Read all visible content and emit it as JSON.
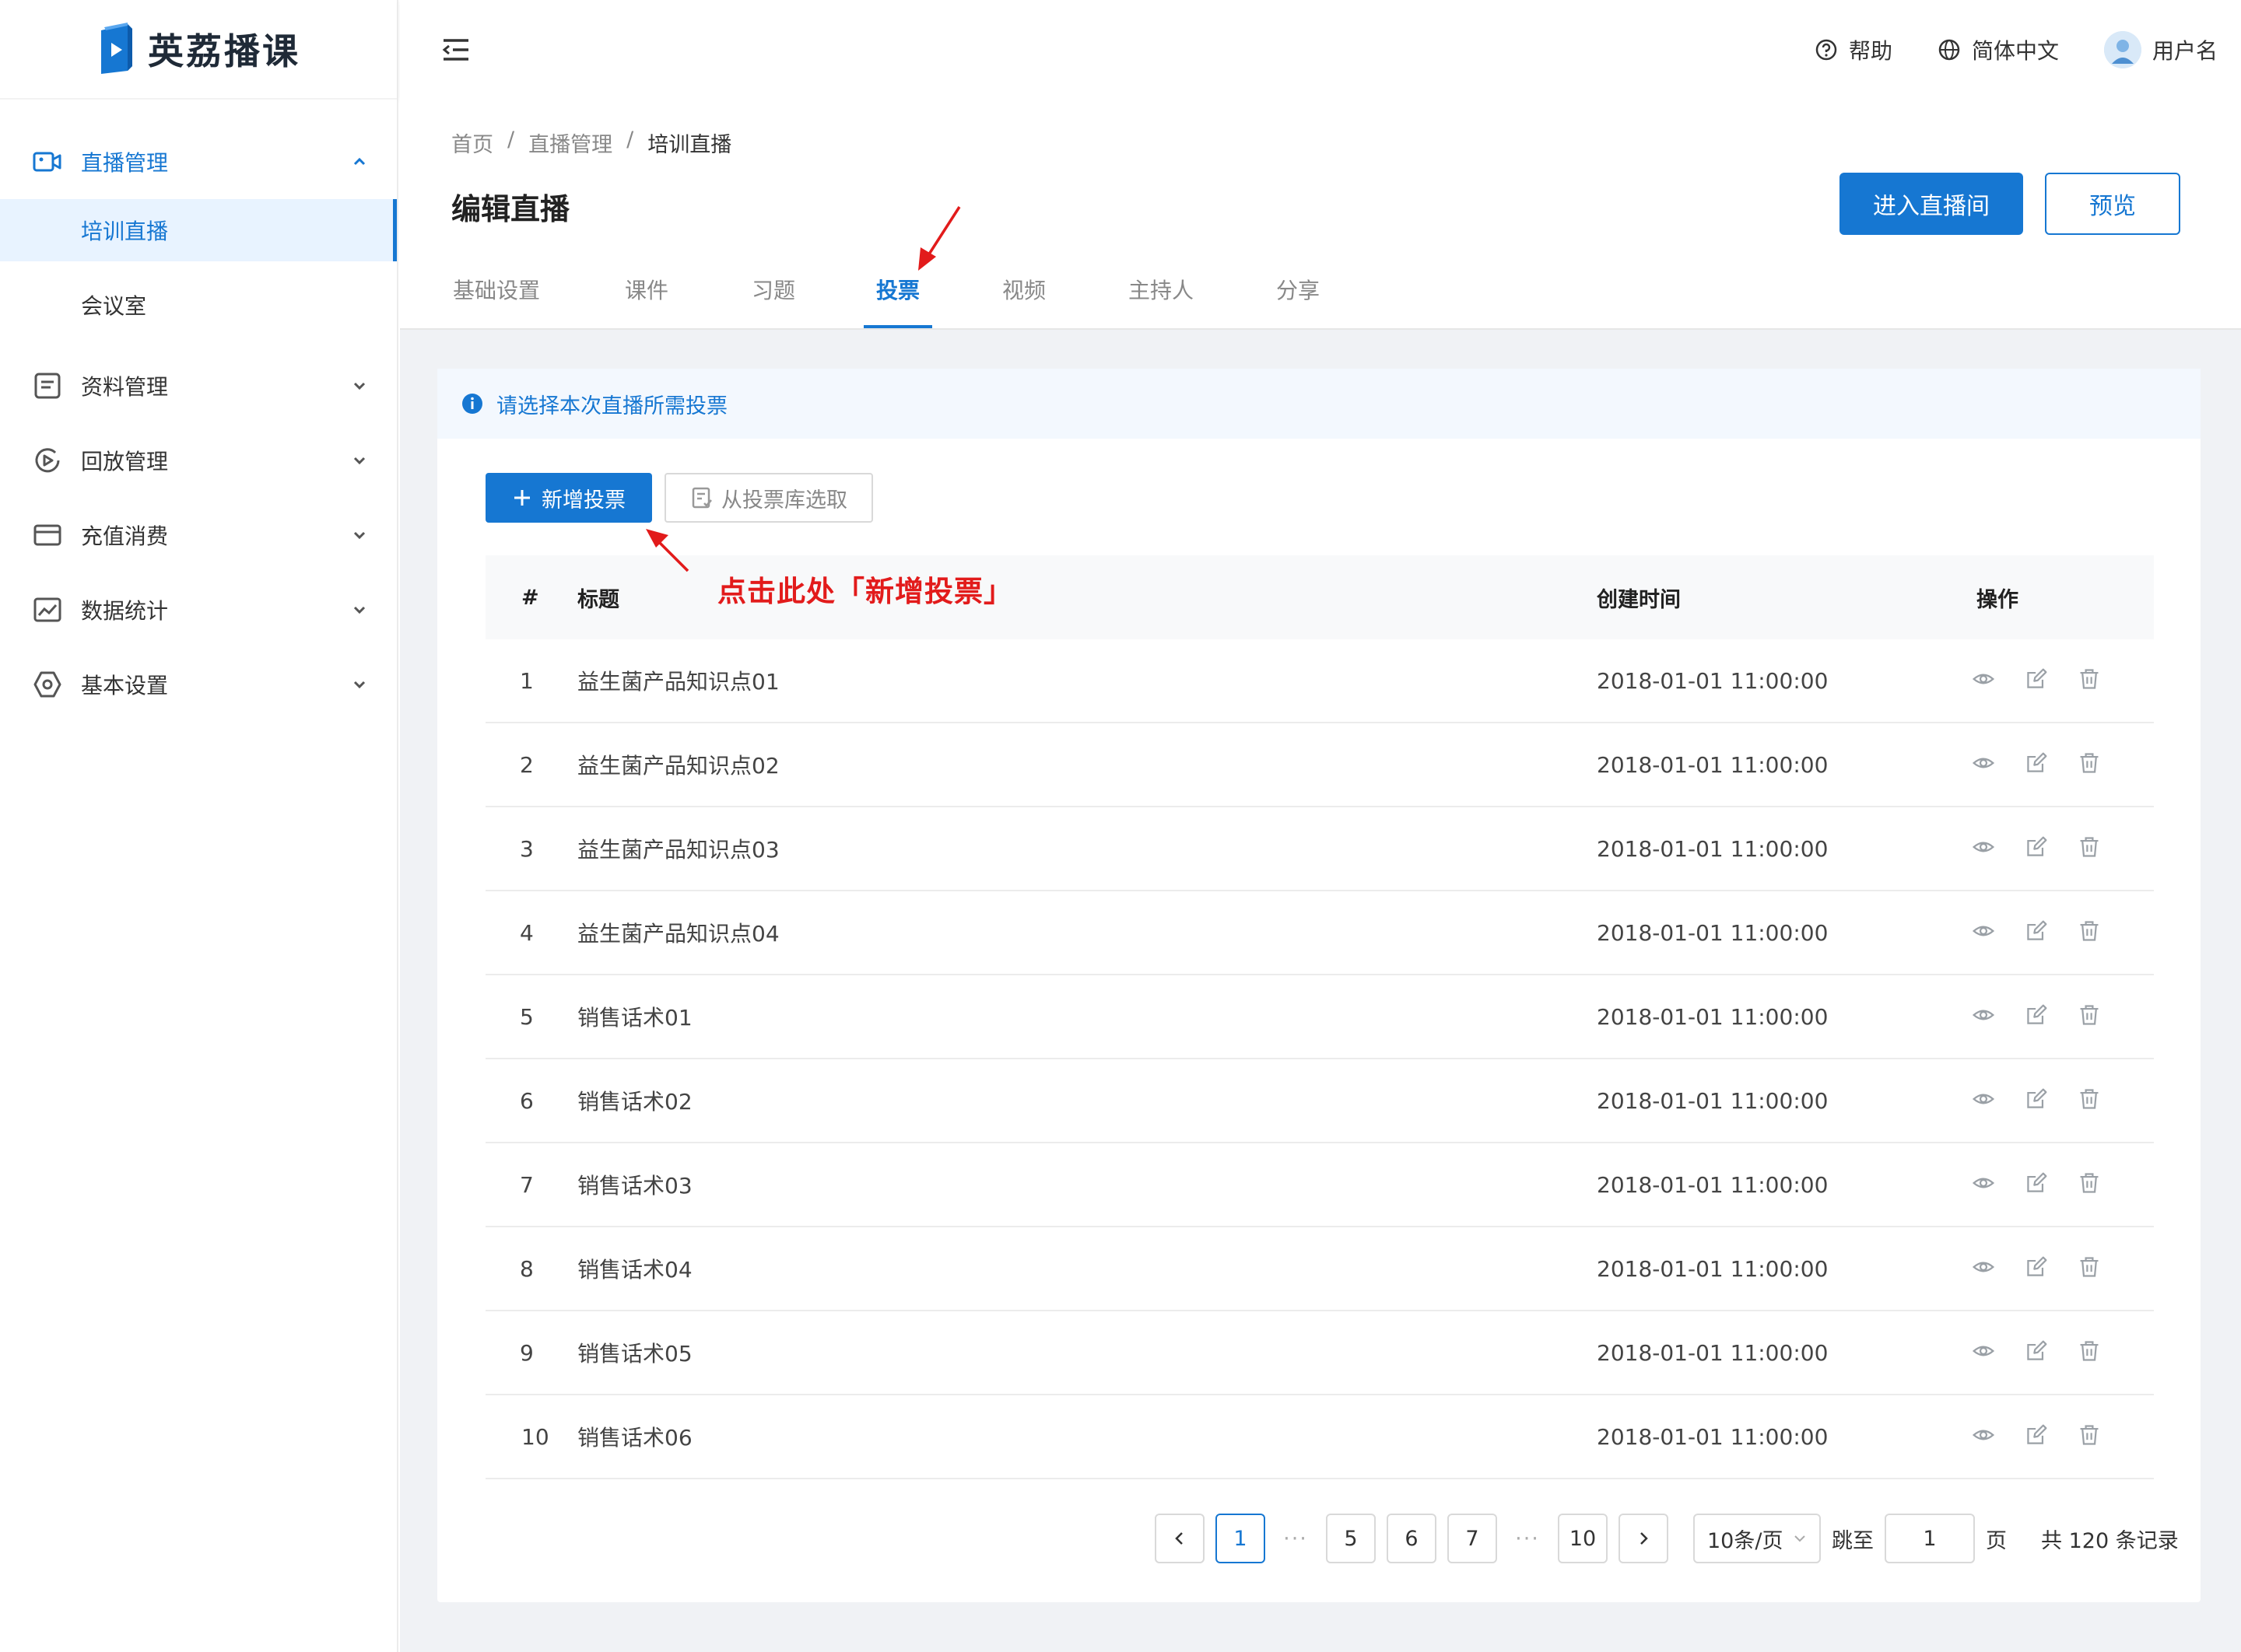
{
  "app": {
    "name": "英荔播课"
  },
  "sidebar": {
    "items": [
      {
        "label": "直播管理"
      },
      {
        "label": "资料管理"
      },
      {
        "label": "回放管理"
      },
      {
        "label": "充值消费"
      },
      {
        "label": "数据统计"
      },
      {
        "label": "基本设置"
      }
    ],
    "sub_items": [
      {
        "label": "培训直播"
      },
      {
        "label": "会议室"
      }
    ]
  },
  "topbar": {
    "help": "帮助",
    "language": "简体中文",
    "username": "用户名"
  },
  "breadcrumb": [
    "首页",
    "直播管理",
    "培训直播"
  ],
  "breadcrumb_sep": "/",
  "page": {
    "title": "编辑直播",
    "enter_button": "进入直播间",
    "preview_button": "预览"
  },
  "tabs": [
    "基础设置",
    "课件",
    "习题",
    "投票",
    "视频",
    "主持人",
    "分享"
  ],
  "active_tab": "投票",
  "notice": "请选择本次直播所需投票",
  "actions": {
    "add": "新增投票",
    "from_library": "从投票库选取"
  },
  "annotation": "点击此处「新增投票」",
  "table": {
    "columns": [
      "#",
      "标题",
      "创建时间",
      "操作"
    ],
    "rows": [
      {
        "idx": "1",
        "title": "益生菌产品知识点01",
        "time": "2018-01-01 11:00:00"
      },
      {
        "idx": "2",
        "title": "益生菌产品知识点02",
        "time": "2018-01-01 11:00:00"
      },
      {
        "idx": "3",
        "title": "益生菌产品知识点03",
        "time": "2018-01-01 11:00:00"
      },
      {
        "idx": "4",
        "title": "益生菌产品知识点04",
        "time": "2018-01-01 11:00:00"
      },
      {
        "idx": "5",
        "title": "销售话术01",
        "time": "2018-01-01 11:00:00"
      },
      {
        "idx": "6",
        "title": "销售话术02",
        "time": "2018-01-01 11:00:00"
      },
      {
        "idx": "7",
        "title": "销售话术03",
        "time": "2018-01-01 11:00:00"
      },
      {
        "idx": "8",
        "title": "销售话术04",
        "time": "2018-01-01 11:00:00"
      },
      {
        "idx": "9",
        "title": "销售话术05",
        "time": "2018-01-01 11:00:00"
      },
      {
        "idx": "10",
        "title": "销售话术06",
        "time": "2018-01-01 11:00:00"
      }
    ],
    "row_actions": [
      "eye-icon",
      "edit-icon",
      "trash-icon"
    ]
  },
  "pagination": {
    "pages": [
      "1",
      "5",
      "6",
      "7",
      "10"
    ],
    "current": "1",
    "ellipsis": "···",
    "page_size": "10条/页",
    "jump_label": "跳至",
    "jump_value": "1",
    "page_unit": "页",
    "total": "共 120 条记录"
  },
  "colors": {
    "primary": "#1677d2",
    "annotation": "#e21b1b",
    "notice_bg": "#f3f8fe",
    "content_bg": "#f0f2f5"
  }
}
